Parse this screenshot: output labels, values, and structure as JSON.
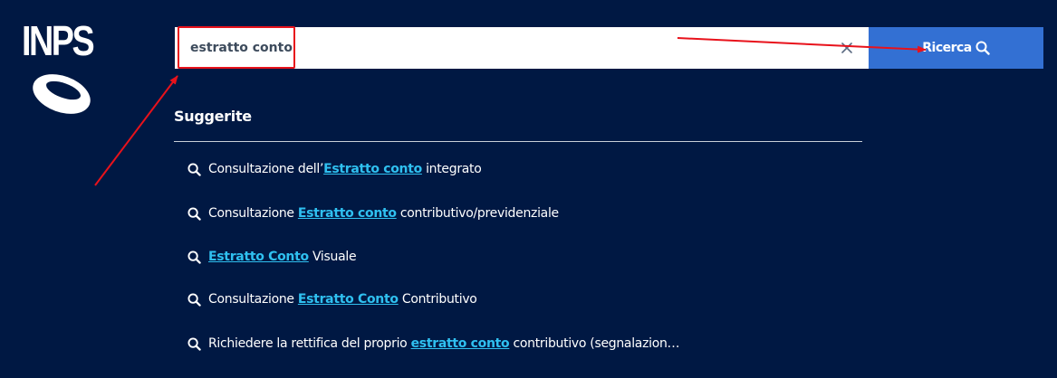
{
  "brand": {
    "logo_text": "INPS"
  },
  "search": {
    "value": "estratto conto",
    "button_label": "Ricerca"
  },
  "suggestions": {
    "title": "Suggerite",
    "items": [
      {
        "pre": "Consultazione dell’",
        "match": "Estratto conto",
        "post": " integrato"
      },
      {
        "pre": "Consultazione ",
        "match": "Estratto conto",
        "post": " contributivo/previdenziale"
      },
      {
        "pre": "",
        "match": "Estratto Conto",
        "post": " Visuale"
      },
      {
        "pre": "Consultazione ",
        "match": "Estratto Conto",
        "post": " Contributivo"
      },
      {
        "pre": "Richiedere la rettifica del proprio ",
        "match": "estratto conto",
        "post": " contributivo (segnalazion…"
      }
    ]
  },
  "icons": {
    "clear": "close-icon",
    "search": "search-icon",
    "logo": "inps-ring-logo"
  },
  "colors": {
    "background": "#001843",
    "button": "#3370d3",
    "match_highlight": "#2fc0f0",
    "annotation": "#e8121b"
  }
}
